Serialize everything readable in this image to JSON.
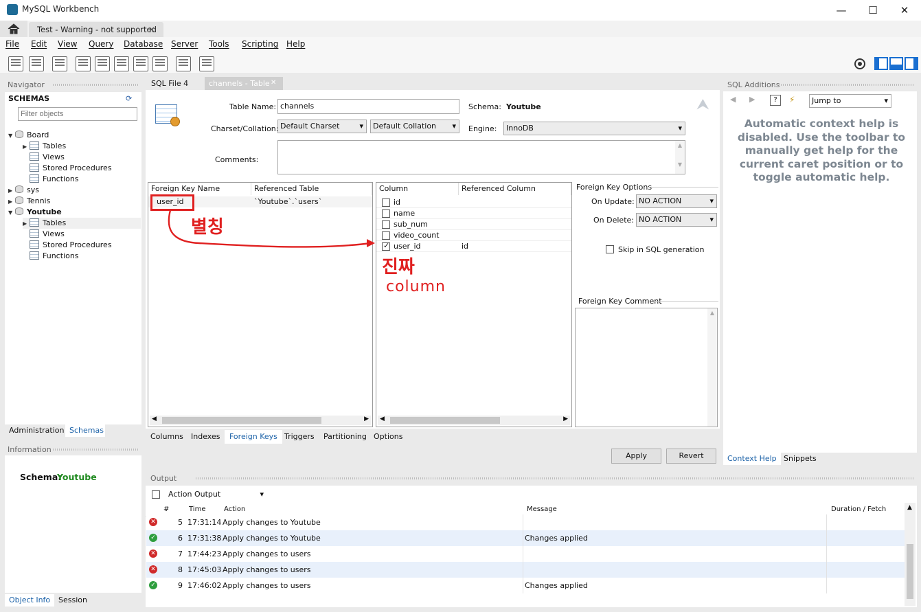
{
  "window": {
    "title": "MySQL Workbench",
    "minimize": "—",
    "maximize": "☐",
    "close": "✕"
  },
  "tab": {
    "label": "Test - Warning - not supported",
    "close": "✕"
  },
  "menu": [
    "File",
    "Edit",
    "View",
    "Query",
    "Database",
    "Server",
    "Tools",
    "Scripting",
    "Help"
  ],
  "navigator": {
    "header": "Navigator",
    "schemas_label": "SCHEMAS",
    "filter_placeholder": "Filter objects",
    "tree": [
      {
        "label": "Board",
        "expanded": true,
        "bold": false
      },
      {
        "label": "Tables",
        "child": true
      },
      {
        "label": "Views",
        "child": true
      },
      {
        "label": "Stored Procedures",
        "child": true
      },
      {
        "label": "Functions",
        "child": true
      },
      {
        "label": "sys",
        "expanded": false
      },
      {
        "label": "Tennis",
        "expanded": false
      },
      {
        "label": "Youtube",
        "expanded": true,
        "bold": true
      },
      {
        "label": "Tables",
        "child": true,
        "selected": true
      },
      {
        "label": "Views",
        "child": true
      },
      {
        "label": "Stored Procedures",
        "child": true
      },
      {
        "label": "Functions",
        "child": true
      }
    ],
    "bottom_tabs": {
      "administration": "Administration",
      "schemas": "Schemas"
    }
  },
  "information": {
    "header": "Information",
    "schema_label": "Schema:",
    "schema_value": "Youtube"
  },
  "bottom_left_tabs": {
    "object_info": "Object Info",
    "session": "Session"
  },
  "editor_tabs": {
    "sql_file": "SQL File 4",
    "table": "channels - Table",
    "close": "✕"
  },
  "table_editor": {
    "table_name_label": "Table Name:",
    "table_name": "channels",
    "schema_label": "Schema:",
    "schema_value": "Youtube",
    "charset_label": "Charset/Collation:",
    "charset": "Default Charset",
    "collation": "Default Collation",
    "engine_label": "Engine:",
    "engine": "InnoDB",
    "comments_label": "Comments:"
  },
  "fk_grid": {
    "headers": [
      "Foreign Key Name",
      "Referenced Table"
    ],
    "rows": [
      {
        "name": "user_id",
        "table": "`Youtube`.`users`"
      }
    ]
  },
  "col_grid": {
    "headers": [
      "Column",
      "Referenced Column"
    ],
    "rows": [
      {
        "column": "id",
        "checked": false,
        "ref": ""
      },
      {
        "column": "name",
        "checked": false,
        "ref": ""
      },
      {
        "column": "sub_num",
        "checked": false,
        "ref": ""
      },
      {
        "column": "video_count",
        "checked": false,
        "ref": ""
      },
      {
        "column": "user_id",
        "checked": true,
        "ref": "id"
      }
    ]
  },
  "fk_options": {
    "title": "Foreign Key Options",
    "on_update_label": "On Update:",
    "on_update": "NO ACTION",
    "on_delete_label": "On Delete:",
    "on_delete": "NO ACTION",
    "skip_label": "Skip in SQL generation",
    "comment_label": "Foreign Key Comment"
  },
  "annotations": {
    "alias": "별칭",
    "real": "진짜",
    "column": "column",
    "color": "#e02020"
  },
  "subtabs": [
    "Columns",
    "Indexes",
    "Foreign Keys",
    "Triggers",
    "Partitioning",
    "Options"
  ],
  "actions": {
    "apply": "Apply",
    "revert": "Revert"
  },
  "sql_additions": {
    "header": "SQL Additions",
    "jump_to": "Jump to",
    "help_text": "Automatic context help is disabled. Use the toolbar to manually get help for the current caret position or to toggle automatic help.",
    "tabs": {
      "context_help": "Context Help",
      "snippets": "Snippets"
    }
  },
  "output": {
    "header": "Output",
    "selector": "Action Output",
    "columns": [
      "#",
      "Time",
      "Action",
      "Message",
      "Duration / Fetch"
    ],
    "rows": [
      {
        "status": "error",
        "n": "5",
        "time": "17:31:14",
        "action": "Apply changes to Youtube",
        "message": ""
      },
      {
        "status": "ok",
        "n": "6",
        "time": "17:31:38",
        "action": "Apply changes to Youtube",
        "message": "Changes applied"
      },
      {
        "status": "error",
        "n": "7",
        "time": "17:44:23",
        "action": "Apply changes to users",
        "message": ""
      },
      {
        "status": "error",
        "n": "8",
        "time": "17:45:03",
        "action": "Apply changes to users",
        "message": ""
      },
      {
        "status": "ok",
        "n": "9",
        "time": "17:46:02",
        "action": "Apply changes to users",
        "message": "Changes applied"
      }
    ]
  }
}
